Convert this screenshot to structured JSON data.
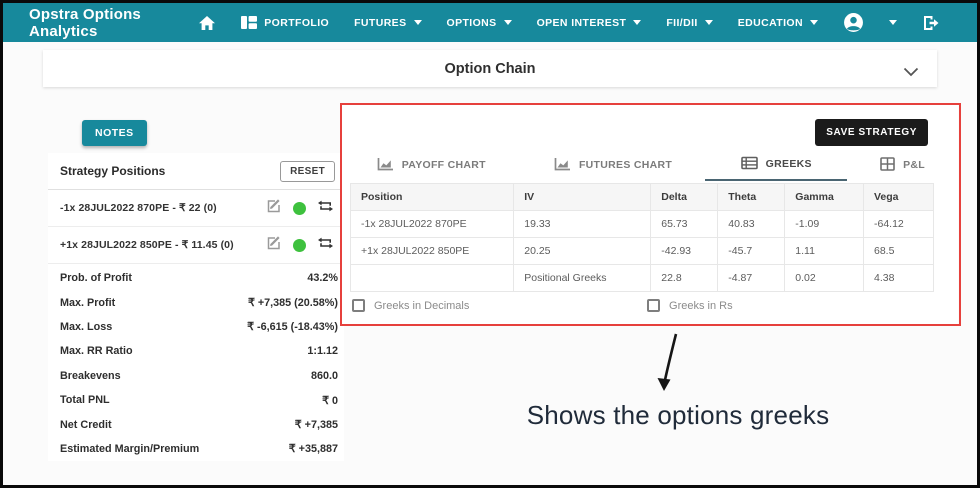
{
  "navbar": {
    "brand": "Opstra Options Analytics",
    "items": [
      {
        "label": "PORTFOLIO",
        "icon": "grid-icon",
        "caret": false
      },
      {
        "label": "FUTURES",
        "caret": true
      },
      {
        "label": "OPTIONS",
        "caret": true
      },
      {
        "label": "OPEN INTEREST",
        "caret": true
      },
      {
        "label": "FII/DII",
        "caret": true
      },
      {
        "label": "EDUCATION",
        "caret": true
      }
    ],
    "icons": [
      "home-icon",
      "account-icon",
      "caret-down-icon",
      "logout-icon"
    ]
  },
  "option_chain": {
    "title": "Option Chain",
    "icon": "chevron-down-icon"
  },
  "left_panel": {
    "notes_label": "NOTES",
    "positions_header": "Strategy Positions",
    "reset_label": "RESET",
    "positions": [
      {
        "text": "-1x  28JUL2022  870PE - ₹ 22   (0)",
        "status_color": "#3ec13e"
      },
      {
        "text": "+1x  28JUL2022  850PE - ₹ 11.45   (0)",
        "status_color": "#3ec13e"
      }
    ],
    "stats": [
      {
        "label": "Prob. of Profit",
        "value": "43.2%"
      },
      {
        "label": "Max. Profit",
        "value": "₹ +7,385 (20.58%)"
      },
      {
        "label": "Max. Loss",
        "value": "₹ -6,615 (-18.43%)"
      },
      {
        "label": "Max. RR Ratio",
        "value": "1:1.12"
      },
      {
        "label": "Breakevens",
        "value": "860.0"
      },
      {
        "label": "Total PNL",
        "value": "₹ 0"
      },
      {
        "label": "Net Credit",
        "value": "₹ +7,385"
      },
      {
        "label": "Estimated Margin/Premium",
        "value": "₹ +35,887"
      }
    ]
  },
  "greeks_panel": {
    "save_button": "SAVE STRATEGY",
    "tabs": [
      {
        "label": "PAYOFF CHART",
        "icon": "area-chart-icon",
        "active": false
      },
      {
        "label": "FUTURES CHART",
        "icon": "area-chart-icon",
        "active": false
      },
      {
        "label": "GREEKS",
        "icon": "table-rows-icon",
        "active": true
      },
      {
        "label": "P&L",
        "icon": "grid-icon",
        "active": false
      }
    ],
    "table": {
      "columns": [
        "Position",
        "IV",
        "Delta",
        "Theta",
        "Gamma",
        "Vega"
      ],
      "rows": [
        [
          "-1x 28JUL2022 870PE",
          "19.33",
          "65.73",
          "40.83",
          "-1.09",
          "-64.12"
        ],
        [
          "+1x 28JUL2022 850PE",
          "20.25",
          "-42.93",
          "-45.7",
          "1.11",
          "68.5"
        ],
        [
          "",
          "Positional Greeks",
          "22.8",
          "-4.87",
          "0.02",
          "4.38"
        ]
      ]
    },
    "checkboxes": [
      {
        "label": "Greeks in Decimals",
        "checked": false
      },
      {
        "label": "Greeks in Rs",
        "checked": false
      }
    ]
  },
  "annotation": {
    "caption": "Shows the options greeks",
    "box_color": "#e6403c"
  },
  "colors": {
    "teal": "#17899c",
    "red": "#e6403c",
    "green": "#3ec13e",
    "save_button_bg": "#1b1b1b",
    "caption_text": "#202b3a"
  }
}
